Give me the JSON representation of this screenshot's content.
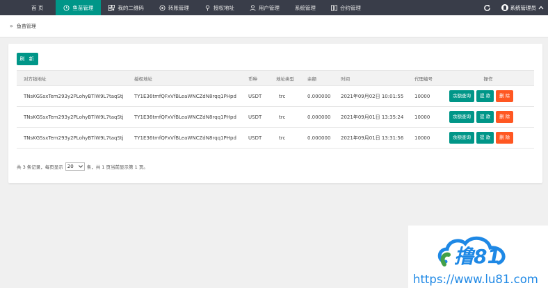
{
  "nav": {
    "home": "首 页",
    "items": [
      {
        "label": "鱼苗管理",
        "icon": "clock-icon",
        "active": true
      },
      {
        "label": "我的二维码",
        "icon": "qrcode-icon",
        "active": false
      },
      {
        "label": "转账管理",
        "icon": "transfer-icon",
        "active": false
      },
      {
        "label": "授权地址",
        "icon": "location-icon",
        "active": false
      },
      {
        "label": "用户管理",
        "icon": "user-icon",
        "active": false
      },
      {
        "label": "系统管理",
        "icon": "",
        "active": false
      },
      {
        "label": "合约管理",
        "icon": "columns-icon",
        "active": false
      }
    ],
    "admin": "系统管理员"
  },
  "breadcrumb": {
    "label": "鱼苗管理"
  },
  "toolbar": {
    "refresh_label": "刷 新"
  },
  "table": {
    "headers": {
      "owner": "对方钱地址",
      "auth": "授权地址",
      "currency": "币种",
      "type": "地址类型",
      "balance": "余额",
      "time": "时间",
      "agent": "代理编号",
      "actions": "操作"
    },
    "action_labels": {
      "query": "余额查询",
      "withdraw": "提 款",
      "delete": "删 除"
    },
    "rows": [
      {
        "owner": "TNsKGSsxTem293y2PLohyBTiW9L7taqStj",
        "auth": "TY1E36tmfQFxVfBLeaWNCZdN8rqq1PHpd",
        "currency": "USDT",
        "type": "trc",
        "balance": "0.000000",
        "time": "2021年09月02日 10:01:55",
        "agent": "10000"
      },
      {
        "owner": "TNsKGSsxTem293y2PLohyBTiW9L7taqStj",
        "auth": "TY1E36tmfQFxVfBLeaWNCZdN8rqq1PHpd",
        "currency": "USDT",
        "type": "trc",
        "balance": "0.000000",
        "time": "2021年09月01日 13:35:24",
        "agent": "10000"
      },
      {
        "owner": "TNsKGSsxTem293y2PLohyBTiW9L7taqStj",
        "auth": "TY1E36tmfQFxVfBLeaWNCZdN8rqq1PHpd",
        "currency": "USDT",
        "type": "trc",
        "balance": "0.000000",
        "time": "2021年09月01日 13:31:56",
        "agent": "10000"
      }
    ]
  },
  "pager": {
    "prefix": "共 3 条记录，每页显示",
    "page_size": "20",
    "suffix": "条，共 1 页当前显示第 1 页。"
  },
  "watermark": {
    "logo_text": "撸81",
    "url": "https://www.lu81.com"
  },
  "colors": {
    "nav_bg": "#393d49",
    "accent": "#009688",
    "danger": "#ff5722",
    "watermark_blue": "#1e88e5"
  }
}
